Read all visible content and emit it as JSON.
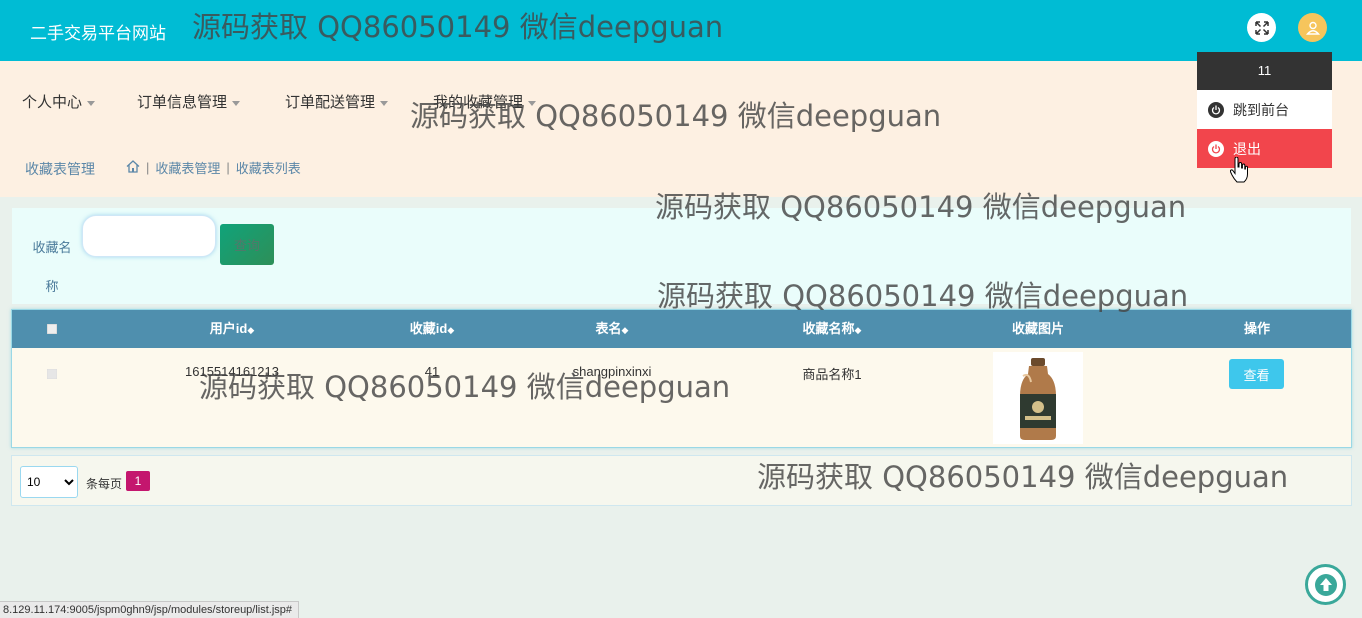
{
  "header": {
    "site_title": "二手交易平台网站"
  },
  "watermark": "源码获取 QQ86050149 微信deepguan",
  "user_menu": {
    "username": "11",
    "to_front": "跳到前台",
    "logout": "退出"
  },
  "nav": {
    "items": [
      "个人中心",
      "订单信息管理",
      "订单配送管理",
      "我的收藏管理"
    ]
  },
  "breadcrumb": {
    "title": "收藏表管理",
    "path": [
      "收藏表管理",
      "收藏表列表"
    ]
  },
  "search": {
    "label": "收藏名称",
    "value": "",
    "button": "查询"
  },
  "table": {
    "columns": [
      "用户id",
      "收藏id",
      "表名",
      "收藏名称",
      "收藏图片",
      "操作"
    ],
    "sortable": [
      true,
      true,
      true,
      true,
      false,
      false
    ],
    "rows": [
      {
        "user_id": "1615514161213",
        "fav_id": "41",
        "table_name": "shangpinxinxi",
        "fav_name": "商品名称1",
        "action": "查看"
      }
    ]
  },
  "pagination": {
    "page_size": "10",
    "page_size_options": [
      "10"
    ],
    "per_page_label": "条每页",
    "current_page": "1"
  },
  "status_url": "8.129.11.174:9005/jspm0ghn9/jsp/modules/storeup/list.jsp#",
  "colors": {
    "topbar": "#00bcd4",
    "nav_bg": "#fdf0e2",
    "table_head": "#4f8fae",
    "logout": "#f2454c",
    "view_button": "#3ec7ec",
    "page_active": "#c4166e"
  }
}
